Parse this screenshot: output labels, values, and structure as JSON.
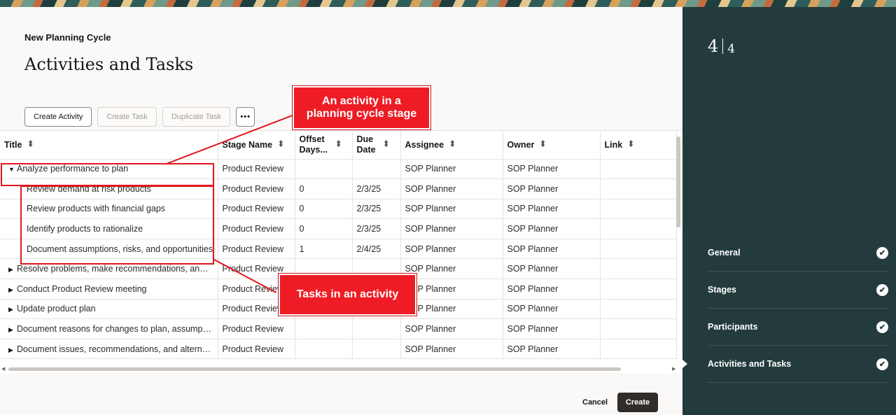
{
  "header": {
    "eyebrow": "New Planning Cycle",
    "title": "Activities and Tasks"
  },
  "toolbar": {
    "create_activity": "Create Activity",
    "create_task": "Create Task",
    "duplicate_task": "Duplicate Task",
    "more": "•••"
  },
  "table": {
    "columns": [
      "Title",
      "Stage Name",
      "Offset Days...",
      "Due Date",
      "Assignee",
      "Owner",
      "Link"
    ],
    "rows": [
      {
        "type": "activity-expanded",
        "title": "Analyze performance to plan",
        "stage": "Product Review",
        "offset": "",
        "due": "",
        "assignee": "SOP Planner",
        "owner": "SOP Planner",
        "link": ""
      },
      {
        "type": "task",
        "title": "Review demand at risk products",
        "stage": "Product Review",
        "offset": "0",
        "due": "2/3/25",
        "assignee": "SOP Planner",
        "owner": "SOP Planner",
        "link": ""
      },
      {
        "type": "task",
        "title": "Review products with financial gaps",
        "stage": "Product Review",
        "offset": "0",
        "due": "2/3/25",
        "assignee": "SOP Planner",
        "owner": "SOP Planner",
        "link": ""
      },
      {
        "type": "task",
        "title": "Identify products to rationalize",
        "stage": "Product Review",
        "offset": "0",
        "due": "2/3/25",
        "assignee": "SOP Planner",
        "owner": "SOP Planner",
        "link": ""
      },
      {
        "type": "task",
        "title": "Document assumptions, risks, and opportunities",
        "stage": "Product Review",
        "offset": "1",
        "due": "2/4/25",
        "assignee": "SOP Planner",
        "owner": "SOP Planner",
        "link": ""
      },
      {
        "type": "activity",
        "title": "Resolve problems, make recommendations, and ...",
        "stage": "Product Review",
        "offset": "",
        "due": "",
        "assignee": "SOP Planner",
        "owner": "SOP Planner",
        "link": ""
      },
      {
        "type": "activity",
        "title": "Conduct Product Review meeting",
        "stage": "Product Review",
        "offset": "",
        "due": "",
        "assignee": "SOP Planner",
        "owner": "SOP Planner",
        "link": ""
      },
      {
        "type": "activity",
        "title": "Update product plan",
        "stage": "Product Review",
        "offset": "",
        "due": "",
        "assignee": "SOP Planner",
        "owner": "SOP Planner",
        "link": ""
      },
      {
        "type": "activity",
        "title": "Document reasons for changes to plan, assumpti...",
        "stage": "Product Review",
        "offset": "",
        "due": "",
        "assignee": "SOP Planner",
        "owner": "SOP Planner",
        "link": ""
      },
      {
        "type": "activity",
        "title": "Document issues, recommendations, and alterna...",
        "stage": "Product Review",
        "offset": "",
        "due": "",
        "assignee": "SOP Planner",
        "owner": "SOP Planner",
        "link": ""
      }
    ]
  },
  "footer": {
    "cancel": "Cancel",
    "create": "Create"
  },
  "rail": {
    "current": "4",
    "total": "4",
    "steps": [
      {
        "label": "General",
        "done": true
      },
      {
        "label": "Stages",
        "done": true
      },
      {
        "label": "Participants",
        "done": true
      },
      {
        "label": "Activities and Tasks",
        "done": true,
        "current": true
      }
    ],
    "check": "✔"
  },
  "callouts": {
    "activity": "An activity in a planning cycle stage",
    "tasks": "Tasks in an activity"
  },
  "colors": {
    "rail_bg": "#233b3d",
    "callout_red": "#ee1c25",
    "primary_button": "#312d2a"
  }
}
